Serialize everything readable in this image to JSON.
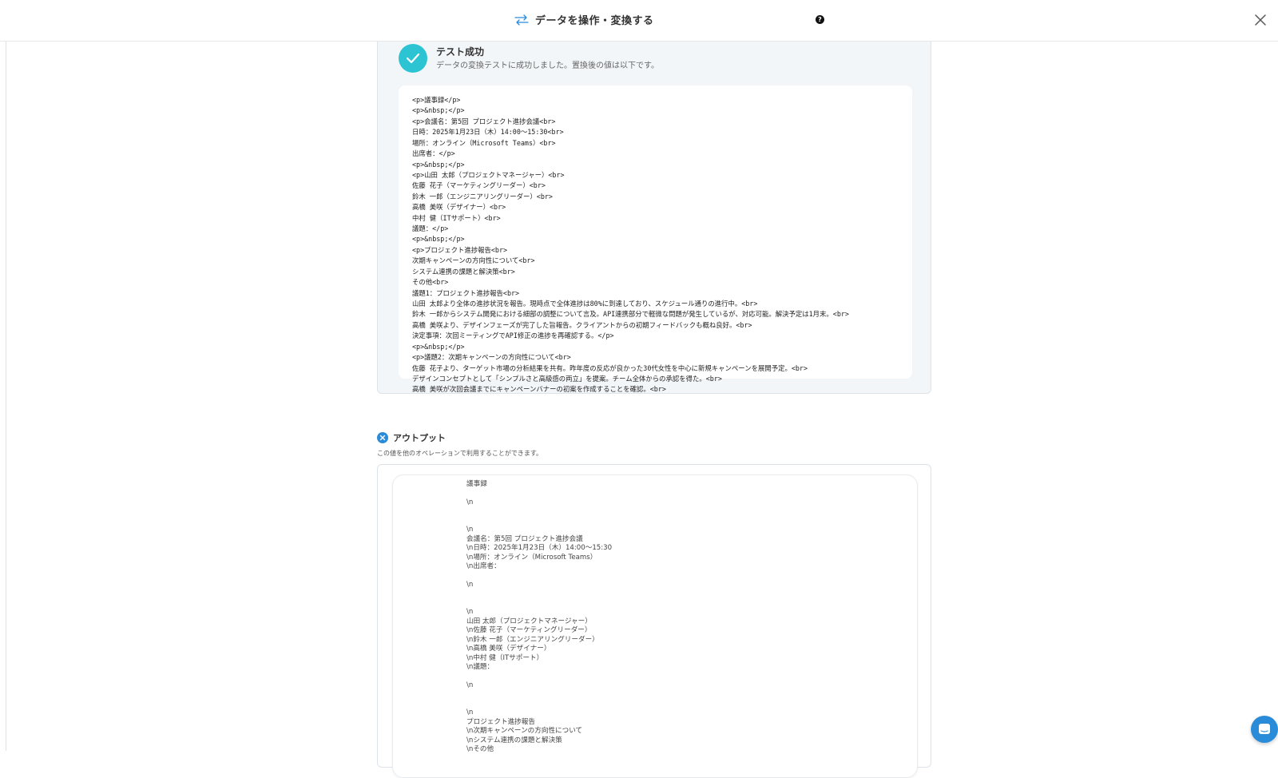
{
  "header": {
    "title": "データを操作・変換する",
    "icons": [
      "transform-arrows-icon",
      "help-icon",
      "close-icon"
    ],
    "accent_color": "#2cc3d3"
  },
  "result": {
    "title": "テスト成功",
    "description": "データの変換テストに成功しました。置換後の値は以下です。",
    "lines": [
      "<p>議事録</p>",
      "<p>&nbsp;</p>",
      "<p>会議名：第5回 プロジェクト進捗会議<br>",
      "日時：2025年1月23日（木）14:00〜15:30<br>",
      "場所：オンライン（Microsoft Teams）<br>",
      "出席者：</p>",
      "<p>&nbsp;</p>",
      "<p>山田 太郎（プロジェクトマネージャー）<br>",
      "佐藤 花子（マーケティングリーダー）<br>",
      "鈴木 一郎（エンジニアリングリーダー）<br>",
      "高橋 美咲（デザイナー）<br>",
      "中村 健（ITサポート）<br>",
      "議題：</p>",
      "<p>&nbsp;</p>",
      "<p>プロジェクト進捗報告<br>",
      "次期キャンペーンの方向性について<br>",
      "システム連携の課題と解決策<br>",
      "その他<br>",
      "議題1：プロジェクト進捗報告<br>",
      "山田 太郎より全体の進捗状況を報告。現時点で全体進捗は80%に到達しており、スケジュール通りの進行中。<br>",
      "鈴木 一郎からシステム開発における細部の調整について言及。API連携部分で軽微な問題が発生しているが、対応可能。解決予定は1月末。<br>",
      "高橋 美咲より、デザインフェーズが完了した旨報告。クライアントからの初期フィードバックも概ね良好。<br>",
      "決定事項：次回ミーティングでAPI修正の進捗を再確認する。</p>",
      "<p>&nbsp;</p>",
      "<p>議題2：次期キャンペーンの方向性について<br>",
      "佐藤 花子より、ターゲット市場の分析結果を共有。昨年度の反応が良かった30代女性を中心に新規キャンペーンを展開予定。<br>",
      "デザインコンセプトとして「シンプルさと高級感の両立」を提案。チーム全体からの承認を得た。<br>",
      "高橋 美咲が次回会議までにキャンペーンバナーの初案を作成することを確認。<br>"
    ]
  },
  "output": {
    "title": "アウトプット",
    "description": "この値を他のオペレーションで利用することができます。",
    "text": "議事録\n\n\\n\n\n\n\\n\n会議名：第5回 プロジェクト進捗会議\n\\n日時：2025年1月23日（木）14:00〜15:30\n\\n場所：オンライン（Microsoft Teams）\n\\n出席者：\n\n\\n\n\n\n\\n\n山田 太郎（プロジェクトマネージャー）\n\\n佐藤 花子（マーケティングリーダー）\n\\n鈴木 一郎（エンジニアリングリーダー）\n\\n高橋 美咲（デザイナー）\n\\n中村 健（ITサポート）\n\\n議題：\n\n\\n\n\n\n\\n\nプロジェクト進捗報告\n\\n次期キャンペーンの方向性について\n\\nシステム連携の課題と解決策\n\\nその他"
  }
}
